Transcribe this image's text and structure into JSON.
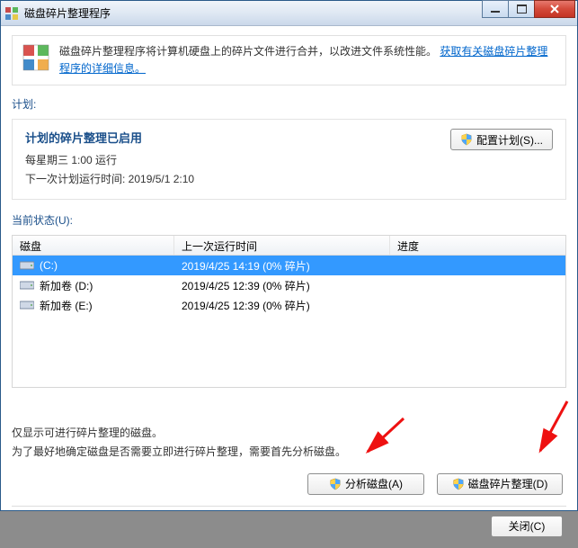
{
  "window": {
    "title": "磁盘碎片整理程序"
  },
  "banner": {
    "text": "磁盘碎片整理程序将计算机硬盘上的碎片文件进行合并，以改进文件系统性能。",
    "link": "获取有关磁盘碎片整理程序的详细信息。"
  },
  "schedule": {
    "section_label": "计划:",
    "title": "计划的碎片整理已启用",
    "line1": "每星期三  1:00 运行",
    "line2": "下一次计划运行时间: 2019/5/1 2:10",
    "configure_btn": "配置计划(S)..."
  },
  "status": {
    "section_label": "当前状态(U):",
    "columns": {
      "disk": "磁盘",
      "last": "上一次运行时间",
      "progress": "进度"
    },
    "disks": [
      {
        "name": "(C:)",
        "last": "2019/4/25 14:19 (0% 碎片)",
        "progress": "",
        "selected": true
      },
      {
        "name": "新加卷 (D:)",
        "last": "2019/4/25 12:39 (0% 碎片)",
        "progress": "",
        "selected": false
      },
      {
        "name": "新加卷 (E:)",
        "last": "2019/4/25 12:39 (0% 碎片)",
        "progress": "",
        "selected": false
      }
    ]
  },
  "hint": {
    "line1": "仅显示可进行碎片整理的磁盘。",
    "line2": "为了最好地确定磁盘是否需要立即进行碎片整理，需要首先分析磁盘。"
  },
  "buttons": {
    "analyze": "分析磁盘(A)",
    "defrag": "磁盘碎片整理(D)",
    "close": "关闭(C)"
  }
}
